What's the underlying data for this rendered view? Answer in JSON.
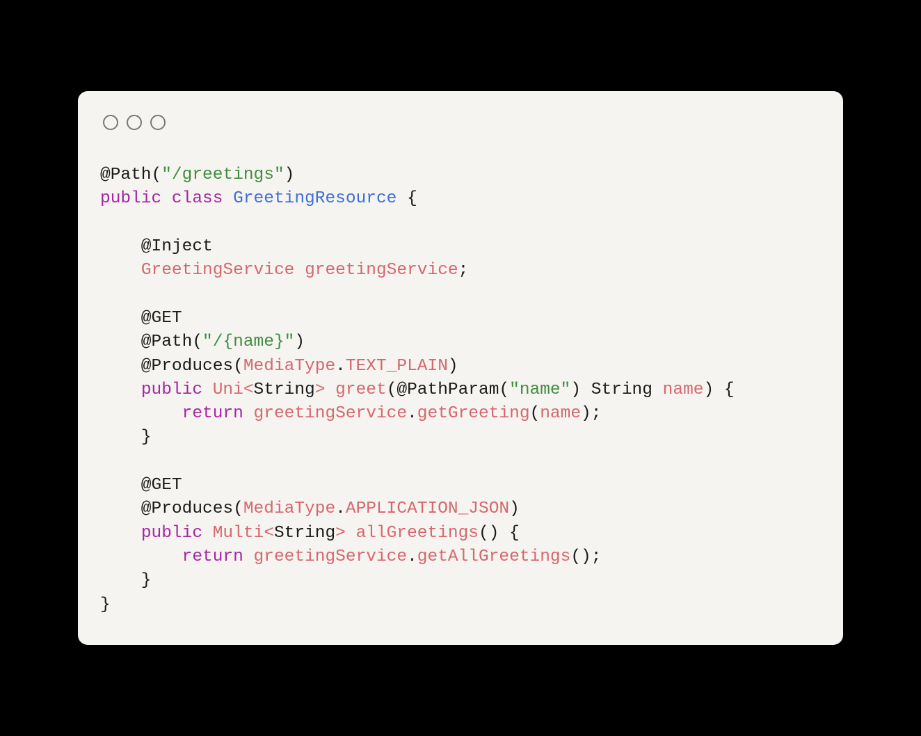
{
  "code": {
    "tokens": [
      [
        [
          "@Path",
          "c-default"
        ],
        [
          "(",
          "c-default"
        ],
        [
          "\"/greetings\"",
          "c-string"
        ],
        [
          ")",
          "c-default"
        ]
      ],
      [
        [
          "public",
          "c-keyword"
        ],
        [
          " ",
          "c-default"
        ],
        [
          "class",
          "c-keyword"
        ],
        [
          " ",
          "c-default"
        ],
        [
          "GreetingResource",
          "c-class"
        ],
        [
          " {",
          "c-default"
        ]
      ],
      [
        [
          "",
          "c-default"
        ]
      ],
      [
        [
          "    @Inject",
          "c-default"
        ]
      ],
      [
        [
          "    ",
          "c-default"
        ],
        [
          "GreetingService",
          "c-salmon"
        ],
        [
          " ",
          "c-default"
        ],
        [
          "greetingService",
          "c-salmon"
        ],
        [
          ";",
          "c-default"
        ]
      ],
      [
        [
          "",
          "c-default"
        ]
      ],
      [
        [
          "    @GET",
          "c-default"
        ]
      ],
      [
        [
          "    @Path",
          "c-default"
        ],
        [
          "(",
          "c-default"
        ],
        [
          "\"/{name}\"",
          "c-string"
        ],
        [
          ")",
          "c-default"
        ]
      ],
      [
        [
          "    @Produces",
          "c-default"
        ],
        [
          "(",
          "c-default"
        ],
        [
          "MediaType",
          "c-salmon"
        ],
        [
          ".",
          "c-default"
        ],
        [
          "TEXT_PLAIN",
          "c-salmon"
        ],
        [
          ")",
          "c-default"
        ]
      ],
      [
        [
          "    ",
          "c-default"
        ],
        [
          "public",
          "c-keyword"
        ],
        [
          " ",
          "c-default"
        ],
        [
          "Uni",
          "c-salmon"
        ],
        [
          "<",
          "c-salmon"
        ],
        [
          "String",
          "c-default"
        ],
        [
          ">",
          "c-salmon"
        ],
        [
          " ",
          "c-default"
        ],
        [
          "greet",
          "c-salmon"
        ],
        [
          "(@PathParam(",
          "c-default"
        ],
        [
          "\"name\"",
          "c-string"
        ],
        [
          ") String ",
          "c-default"
        ],
        [
          "name",
          "c-salmon"
        ],
        [
          ") {",
          "c-default"
        ]
      ],
      [
        [
          "        ",
          "c-default"
        ],
        [
          "return",
          "c-keyword"
        ],
        [
          " ",
          "c-default"
        ],
        [
          "greetingService",
          "c-salmon"
        ],
        [
          ".",
          "c-default"
        ],
        [
          "getGreeting",
          "c-salmon"
        ],
        [
          "(",
          "c-default"
        ],
        [
          "name",
          "c-salmon"
        ],
        [
          ");",
          "c-default"
        ]
      ],
      [
        [
          "    }",
          "c-default"
        ]
      ],
      [
        [
          "",
          "c-default"
        ]
      ],
      [
        [
          "    @GET",
          "c-default"
        ]
      ],
      [
        [
          "    @Produces",
          "c-default"
        ],
        [
          "(",
          "c-default"
        ],
        [
          "MediaType",
          "c-salmon"
        ],
        [
          ".",
          "c-default"
        ],
        [
          "APPLICATION_JSON",
          "c-salmon"
        ],
        [
          ")",
          "c-default"
        ]
      ],
      [
        [
          "    ",
          "c-default"
        ],
        [
          "public",
          "c-keyword"
        ],
        [
          " ",
          "c-default"
        ],
        [
          "Multi",
          "c-salmon"
        ],
        [
          "<",
          "c-salmon"
        ],
        [
          "String",
          "c-default"
        ],
        [
          ">",
          "c-salmon"
        ],
        [
          " ",
          "c-default"
        ],
        [
          "allGreetings",
          "c-salmon"
        ],
        [
          "() {",
          "c-default"
        ]
      ],
      [
        [
          "        ",
          "c-default"
        ],
        [
          "return",
          "c-keyword"
        ],
        [
          " ",
          "c-default"
        ],
        [
          "greetingService",
          "c-salmon"
        ],
        [
          ".",
          "c-default"
        ],
        [
          "getAllGreetings",
          "c-salmon"
        ],
        [
          "();",
          "c-default"
        ]
      ],
      [
        [
          "    }",
          "c-default"
        ]
      ],
      [
        [
          "}",
          "c-default"
        ]
      ]
    ]
  }
}
